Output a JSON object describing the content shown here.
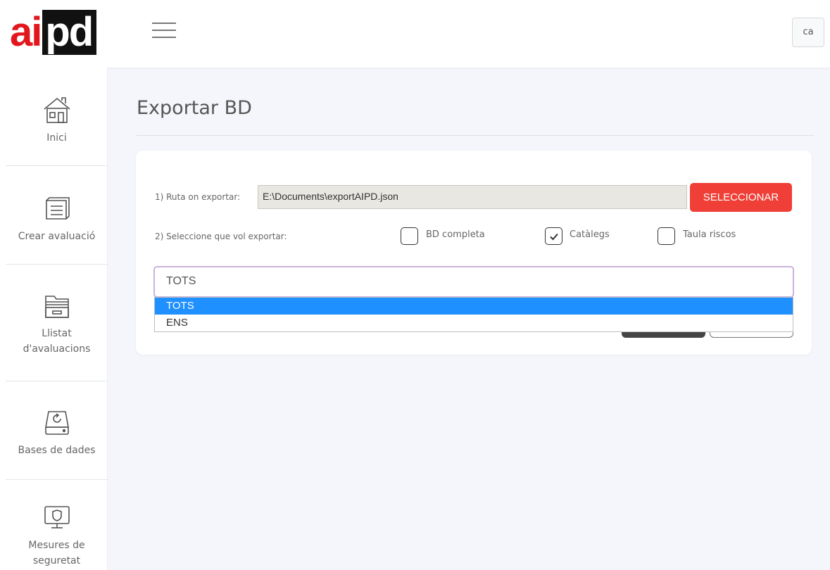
{
  "header": {
    "logo_part1": "ai",
    "logo_part2": "pd",
    "lang": "ca"
  },
  "sidebar": {
    "items": [
      {
        "label": "Inici",
        "icon": "home-icon"
      },
      {
        "label": "Crear avaluació",
        "icon": "form-icon"
      },
      {
        "label": "Llistat d'avaluacions",
        "icon": "folder-icon"
      },
      {
        "label": "Bases de dades",
        "icon": "database-icon"
      },
      {
        "label": "Mesures de seguretat",
        "icon": "monitor-shield-icon"
      }
    ]
  },
  "main": {
    "title": "Exportar BD",
    "path_label": "1) Ruta on exportar:",
    "path_value": "E:\\Documents\\exportAIPD.json",
    "select_button": "SELECCIONAR",
    "what_label": "2) Seleccione que vol exportar:",
    "options": [
      {
        "label": "BD completa",
        "checked": false
      },
      {
        "label": "Catàlegs",
        "checked": true
      },
      {
        "label": "Taula riscos",
        "checked": false
      }
    ],
    "dropdown": {
      "selected": "TOTS",
      "options": [
        "TOTS",
        "ENS"
      ],
      "highlighted": "TOTS"
    }
  },
  "colors": {
    "accent_red": "#ef3f36",
    "highlight_blue": "#1e90ff",
    "logo_red": "#e2171d"
  }
}
